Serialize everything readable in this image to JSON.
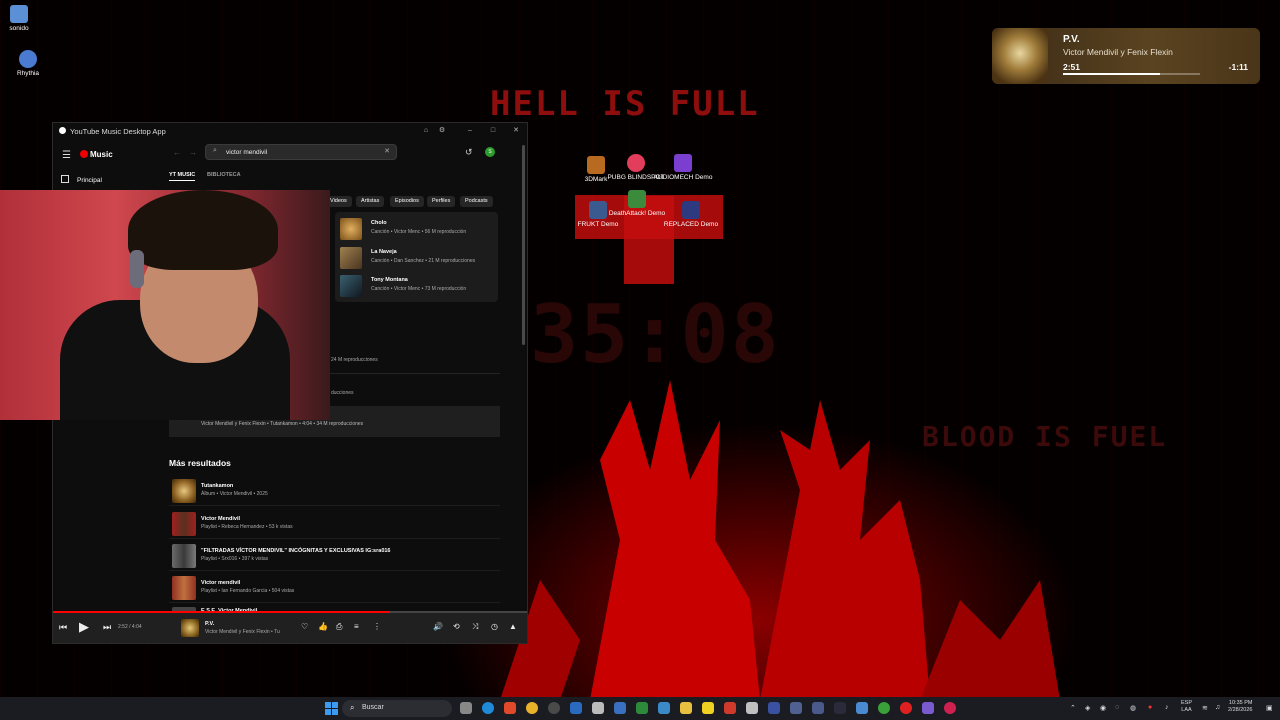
{
  "wallpaper": {
    "headline": "HELL IS FULL",
    "clock": "35:08",
    "tagline": "BLOOD IS FUEL"
  },
  "desktop_icons": [
    {
      "label": "sonido"
    },
    {
      "label": "Rhythia"
    },
    {
      "label": "3DMark"
    },
    {
      "label": "PUBG BLINDSPOT"
    },
    {
      "label": "AUDIOMECH Demo"
    },
    {
      "label": "FRUKT Demo"
    },
    {
      "label": "DeathAttack! Demo"
    },
    {
      "label": "REPLACED Demo"
    }
  ],
  "media_flyout": {
    "title": "P.V.",
    "artist": "Victor Mendivil y Fenix Flexin",
    "elapsed": "2:51",
    "remaining": "-1:11",
    "progress": 0.71
  },
  "app": {
    "title": "YouTube Music Desktop App",
    "brand": "Music",
    "nav_home": "Principal",
    "search": {
      "value": "victor mendivil",
      "placeholder": "Buscar"
    },
    "avatar_letter": "S",
    "scopes": [
      "YT MUSIC",
      "BIBLIOTECA"
    ],
    "chips": [
      "Videos",
      "Artistas",
      "Episodios",
      "Perfiles",
      "Podcasts"
    ],
    "top_results": [
      {
        "title": "Cholo",
        "subtitle": "Canción • Victor Menc • 56 M reproducción"
      },
      {
        "title": "La Naveja",
        "subtitle": "Canción • Dan Sanchez • 21 M reproducciones"
      },
      {
        "title": "Tony Montana",
        "subtitle": "Canción • Victor Menc • 73 M reproducción"
      }
    ],
    "partial_rows": [
      "24 M reproducciones",
      "ducciones"
    ],
    "selected_row_subtitle": "Victor Mendivil y Fenix Flexin • Tutankamon • 4:04 • 34 M reproducciones",
    "more_results_title": "Más resultados",
    "more_results": [
      {
        "title": "Tutankamon",
        "subtitle": "Álbum • Victor Mendivil • 2025"
      },
      {
        "title": "Victor Mendivil",
        "subtitle": "Playlist • Rebeca Hernandez • 53 k vistas"
      },
      {
        "title": "\"FILTRADAS VÍCTOR MENDIVIL\" INCÓGNITAS Y EXCLUSIVAS IG:sra016",
        "subtitle": "Playlist • Srx016 • 397 k vistas"
      },
      {
        "title": "Victor mendivil",
        "subtitle": "Playlist • Ian Fernando Garcia • 504 vistas"
      },
      {
        "title": "E.S.E. Victor Mendivil",
        "subtitle": ""
      }
    ],
    "player": {
      "time": "2:52 / 4:04",
      "title": "P.V.",
      "subtitle": "Victor Mendivil y Fenix Flexin • Tu",
      "progress": 0.71
    }
  },
  "taskbar": {
    "search_label": "Buscar",
    "lang": [
      "ESP",
      "LAA"
    ],
    "time": "10:35 PM",
    "date": "2/28/2026"
  }
}
